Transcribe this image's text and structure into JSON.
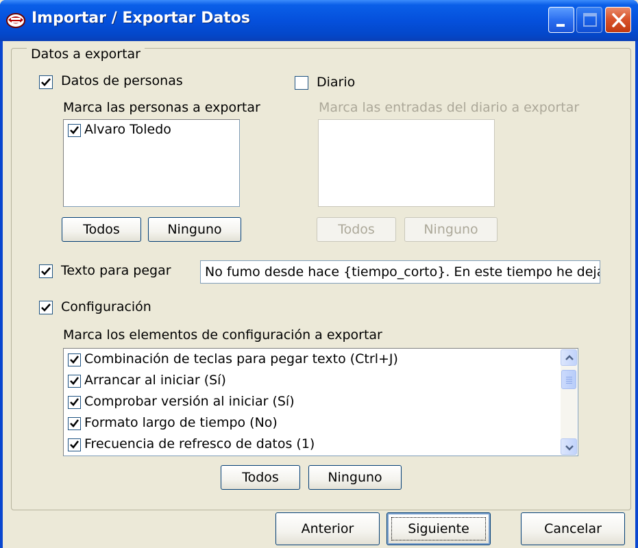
{
  "window": {
    "title": "Importar / Exportar Datos",
    "icon": "smoking-mouth-icon"
  },
  "group": {
    "legend": "Datos a exportar"
  },
  "personas": {
    "checkbox_label": "Datos de personas",
    "checked": true,
    "list_caption": "Marca las personas a exportar",
    "items": [
      {
        "label": "Alvaro Toledo",
        "checked": true
      }
    ],
    "btn_all": "Todos",
    "btn_none": "Ninguno"
  },
  "diario": {
    "checkbox_label": "Diario",
    "checked": false,
    "list_caption": "Marca las entradas del diario a exportar",
    "items": [],
    "btn_all": "Todos",
    "btn_none": "Ninguno"
  },
  "texto": {
    "checkbox_label": "Texto para pegar",
    "checked": true,
    "value": "No fumo desde hace {tiempo_corto}. En este tiempo he dejado"
  },
  "config": {
    "checkbox_label": "Configuración",
    "checked": true,
    "list_caption": "Marca los elementos de configuración a exportar",
    "items": [
      {
        "label": "Combinación de teclas para pegar texto (Ctrl+J)",
        "checked": true
      },
      {
        "label": "Arrancar al iniciar (Sí)",
        "checked": true
      },
      {
        "label": "Comprobar versión al iniciar (Sí)",
        "checked": true
      },
      {
        "label": "Formato largo de tiempo (No)",
        "checked": true
      },
      {
        "label": "Frecuencia de refresco de datos (1)",
        "checked": true
      }
    ],
    "btn_all": "Todos",
    "btn_none": "Ninguno"
  },
  "footer": {
    "btn_back": "Anterior",
    "btn_next": "Siguiente",
    "btn_cancel": "Cancelar"
  },
  "colors": {
    "titlebar": "#0550dc",
    "face": "#ece9d8",
    "disabled_text": "#aca899"
  }
}
